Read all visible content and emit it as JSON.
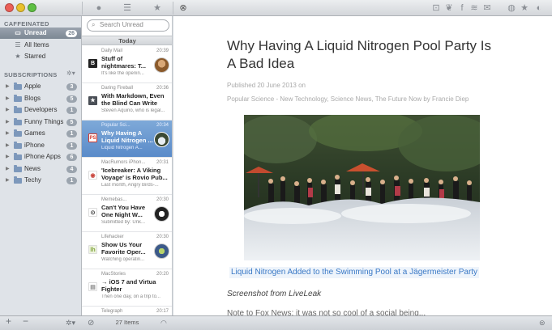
{
  "toolbar": {
    "left_icons": [
      "refresh-icon",
      "list-icon",
      "star-icon",
      "close-icon"
    ],
    "right_icons": [
      "share-icon",
      "twitter-icon",
      "facebook-icon",
      "buffer-icon",
      "email-icon",
      "browser-icon",
      "star-icon",
      "reader-icon"
    ]
  },
  "sidebar": {
    "heading": "CAFFEINATED",
    "top_items": [
      {
        "label": "Unread",
        "badge": "26",
        "icon": "inbox-icon",
        "selected": true
      },
      {
        "label": "All Items",
        "icon": "list-icon"
      },
      {
        "label": "Starred",
        "icon": "star-icon"
      }
    ],
    "subscriptions_heading": "SUBSCRIPTIONS",
    "folders": [
      {
        "label": "Apple",
        "badge": "3"
      },
      {
        "label": "Blogs",
        "badge": "5"
      },
      {
        "label": "Developers",
        "badge": "1"
      },
      {
        "label": "Funny Things",
        "badge": "5"
      },
      {
        "label": "Games",
        "badge": "1"
      },
      {
        "label": "iPhone",
        "badge": "1"
      },
      {
        "label": "iPhone Apps",
        "badge": "6"
      },
      {
        "label": "News",
        "badge": "4"
      },
      {
        "label": "Techy",
        "badge": "1"
      }
    ]
  },
  "list": {
    "search_placeholder": "Search Unread",
    "section": "Today",
    "items": [
      {
        "source": "Daily Mail",
        "time": "20:39",
        "title": "Stuff of nightmares: T...",
        "snippet": "It's like the openin...",
        "favicon": "B",
        "favicon_color": "#222"
      },
      {
        "source": "Daring Fireball",
        "time": "20:36",
        "title": "With Markdown, Even the Blind Can Write",
        "snippet": "Steven Aquino, who is legal...",
        "favicon": "★",
        "favicon_color": "#4a4f56"
      },
      {
        "source": "Popular Sci...",
        "time": "20:34",
        "title": "Why Having A Liquid Nitrogen ...",
        "snippet": "Liquid Nitrogen A...",
        "favicon": "PS",
        "favicon_color": "#d3392d"
      },
      {
        "source": "MacRumors iPhon...",
        "time": "20:31",
        "title": "'Icebreaker: A Viking Voyage' is Rovio Pub...",
        "snippet": "Last month, Angry Birds-...",
        "favicon": "◉",
        "favicon_color": "#c9463d"
      },
      {
        "source": "Memebas...",
        "time": "20:30",
        "title": "Can't You Have One Night W...",
        "snippet": "Submitted by: Unk...",
        "favicon": "⊙",
        "favicon_color": "#333"
      },
      {
        "source": "Lifehacker",
        "time": "20:30",
        "title": "Show Us Your Favorite Oper...",
        "snippet": "Watching operatin...",
        "favicon": "lh",
        "favicon_color": "#7fa33a"
      },
      {
        "source": "MacStories",
        "time": "20:20",
        "title": "→ iOS 7 and Virtua Fighter",
        "snippet": "Then one day, on a trip to...",
        "favicon": "▤",
        "favicon_color": "#888"
      },
      {
        "source": "Telegraph",
        "time": "20:17",
        "title": "",
        "snippet": "",
        "favicon": "",
        "favicon_color": "#888"
      }
    ],
    "count_label": "27 Items"
  },
  "reader": {
    "title": "Why Having A Liquid Nitrogen Pool Party Is A Bad Idea",
    "published": "Published 20 June 2013 on",
    "tags": "Popular Science - New Technology, Science News, The Future Now by Francie Diep",
    "caption_link": "Liquid Nitrogen Added to the Swimming Pool at a Jägermeister Party",
    "note": "Screenshot from LiveLeak",
    "cut_line": "Note to Fox News: it was not so cool of a social being..."
  },
  "colors": {
    "selection": "#5a8bc9",
    "link": "#3a79c6",
    "sidebar_bg": "#dfe3e8"
  }
}
